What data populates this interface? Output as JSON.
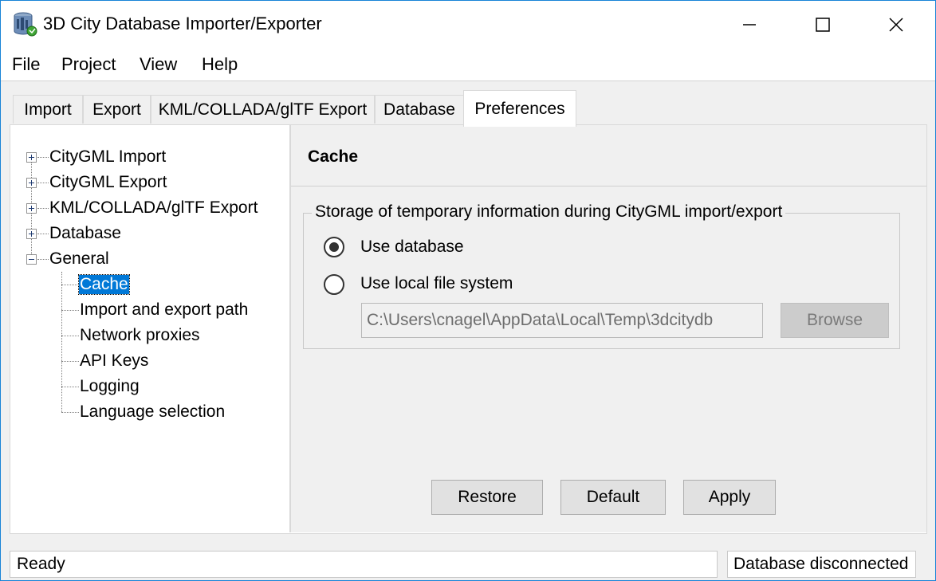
{
  "window": {
    "title": "3D City Database Importer/Exporter",
    "icon": "database-globe-icon",
    "controls": [
      "minimize-icon",
      "maximize-icon",
      "close-icon"
    ]
  },
  "menu": {
    "items": [
      "File",
      "Project",
      "View",
      "Help"
    ]
  },
  "tabs": {
    "items": [
      "Import",
      "Export",
      "KML/COLLADA/glTF Export",
      "Database",
      "Preferences"
    ],
    "active": "Preferences"
  },
  "tree": {
    "nodes": [
      "CityGML Import",
      "CityGML Export",
      "KML/COLLADA/glTF Export",
      "Database",
      "General"
    ],
    "general_children": [
      "Cache",
      "Import and export path",
      "Network proxies",
      "API Keys",
      "Logging",
      "Language selection"
    ],
    "selected": "Cache"
  },
  "panel": {
    "title": "Cache",
    "group_title": "Storage of temporary information during CityGML import/export",
    "option_database": "Use database",
    "option_local": "Use local file system",
    "selected_option": "Use database",
    "path_value": "C:\\Users\\cnagel\\AppData\\Local\\Temp\\3dcitydb",
    "browse_label": "Browse",
    "restore_label": "Restore",
    "default_label": "Default",
    "apply_label": "Apply"
  },
  "status": {
    "left": "Ready",
    "right": "Database disconnected"
  },
  "colors": {
    "selection": "#0078d7",
    "window_border": "#1883d7",
    "panel_background": "#f0f0f0"
  }
}
